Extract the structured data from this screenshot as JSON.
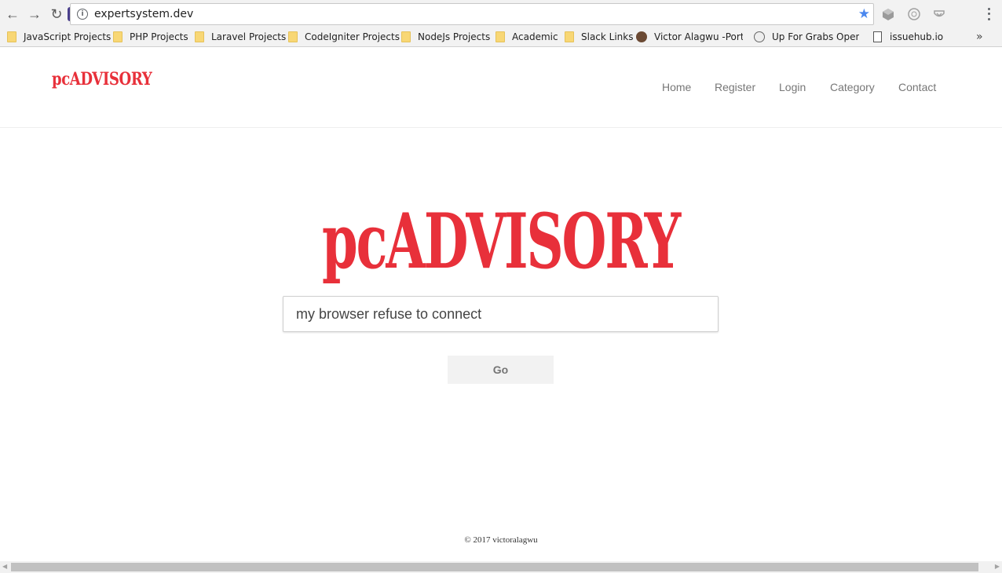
{
  "browser": {
    "url": "expertsystem.dev",
    "bookmarks": [
      {
        "label": "JavaScript Projects",
        "icon": "folder-icon"
      },
      {
        "label": "PHP Projects",
        "icon": "folder-icon"
      },
      {
        "label": "Laravel Projects",
        "icon": "folder-icon"
      },
      {
        "label": "CodeIgniter Projects",
        "icon": "folder-icon"
      },
      {
        "label": "NodeJs Projects",
        "icon": "folder-icon"
      },
      {
        "label": "Academic",
        "icon": "folder-icon"
      },
      {
        "label": "Slack Links",
        "icon": "folder-icon"
      },
      {
        "label": "Victor Alagwu -Portfo",
        "icon": "avatar-icon"
      },
      {
        "label": "Up For Grabs Open S",
        "icon": "globe-icon"
      },
      {
        "label": "issuehub.io",
        "icon": "page-icon"
      }
    ],
    "more_bookmarks": "»"
  },
  "header": {
    "brand": "pcADVISORY",
    "nav": [
      {
        "label": "Home"
      },
      {
        "label": "Register"
      },
      {
        "label": "Login"
      },
      {
        "label": "Category"
      },
      {
        "label": "Contact"
      }
    ]
  },
  "main": {
    "logo": "pcADVISORY",
    "search_value": "my browser refuse to connect",
    "go_label": "Go"
  },
  "footer": {
    "text": "© 2017 victoralagwu"
  },
  "colors": {
    "brand_red": "#e8303a",
    "nav_text": "#777777",
    "button_bg": "#f2f2f2"
  }
}
